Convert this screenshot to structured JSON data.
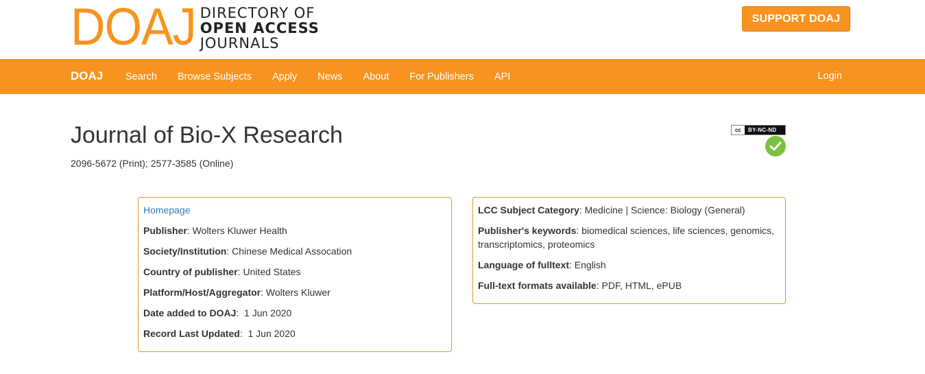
{
  "header": {
    "logo_mark": "DOAJ",
    "logo_lines": [
      "DIRECTORY OF",
      "OPEN ACCESS",
      "JOURNALS"
    ],
    "support_label": "SUPPORT DOAJ"
  },
  "nav": {
    "brand": "DOAJ",
    "items": [
      "Search",
      "Browse Subjects",
      "Apply",
      "News",
      "About",
      "For Publishers",
      "API"
    ],
    "login": "Login"
  },
  "journal": {
    "title": "Journal of Bio-X Research",
    "issn": "2096-5672 (Print); 2577-3585 (Online)",
    "license_cc": "cc",
    "license_label": "BY-NC-ND",
    "seal_icon": "check-seal-icon"
  },
  "left_panel": {
    "homepage": "Homepage",
    "rows": [
      {
        "label": "Publisher",
        "sep": ": ",
        "value": "Wolters Kluwer Health"
      },
      {
        "label": "Society/Institution",
        "sep": ": ",
        "value": "Chinese Medical Assocation"
      },
      {
        "label": "Country of publisher",
        "sep": ": ",
        "value": "United States"
      },
      {
        "label": "Platform/Host/Aggregator",
        "sep": ": ",
        "value": "Wolters Kluwer"
      },
      {
        "label": "Date added to DOAJ",
        "sep": ":  ",
        "value": "1 Jun 2020"
      },
      {
        "label": "Record Last Updated",
        "sep": ":  ",
        "value": "1 Jun 2020"
      }
    ]
  },
  "right_panel": {
    "rows": [
      {
        "label": "LCC Subject Category",
        "sep": ": ",
        "value": "Medicine | Science: Biology (General)"
      },
      {
        "label": "Publisher's keywords",
        "sep": ": ",
        "value": "biomedical sciences, life sciences, genomics, transcriptomics, proteomics"
      },
      {
        "label": "Language of fulltext",
        "sep": ": ",
        "value": "English"
      },
      {
        "label": "Full-text formats available",
        "sep": ": ",
        "value": "PDF, HTML, ePUB"
      }
    ]
  },
  "colors": {
    "brand_orange": "#f7931e",
    "link_blue": "#337ab7",
    "seal_green": "#7ac142"
  }
}
